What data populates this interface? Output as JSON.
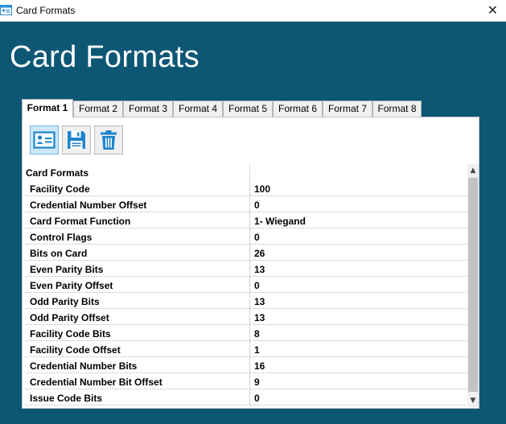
{
  "window": {
    "title": "Card Formats"
  },
  "page": {
    "heading": "Card Formats"
  },
  "tabs": [
    "Format 1",
    "Format 2",
    "Format 3",
    "Format 4",
    "Format 5",
    "Format 6",
    "Format 7",
    "Format 8"
  ],
  "active_tab": "Format 1",
  "toolbar": {
    "icons": [
      "card-icon",
      "save-icon",
      "delete-icon"
    ]
  },
  "grid": {
    "category": "Card Formats",
    "rows": [
      {
        "name": "Facility Code",
        "value": "100"
      },
      {
        "name": "Credential Number Offset",
        "value": "0"
      },
      {
        "name": "Card Format Function",
        "value": "1- Wiegand"
      },
      {
        "name": "Control Flags",
        "value": "0"
      },
      {
        "name": "Bits on Card",
        "value": "26"
      },
      {
        "name": "Even Parity Bits",
        "value": "13"
      },
      {
        "name": "Even Parity Offset",
        "value": "0"
      },
      {
        "name": "Odd Parity Bits",
        "value": "13"
      },
      {
        "name": "Odd Parity Offset",
        "value": "13"
      },
      {
        "name": "Facility Code Bits",
        "value": "8"
      },
      {
        "name": "Facility Code Offset",
        "value": "1"
      },
      {
        "name": "Credential Number Bits",
        "value": "16"
      },
      {
        "name": "Credential Number Bit Offset",
        "value": "9"
      },
      {
        "name": "Issue Code Bits",
        "value": "0"
      }
    ]
  },
  "colors": {
    "background": "#0d5775",
    "accent": "#2a8fd6"
  }
}
